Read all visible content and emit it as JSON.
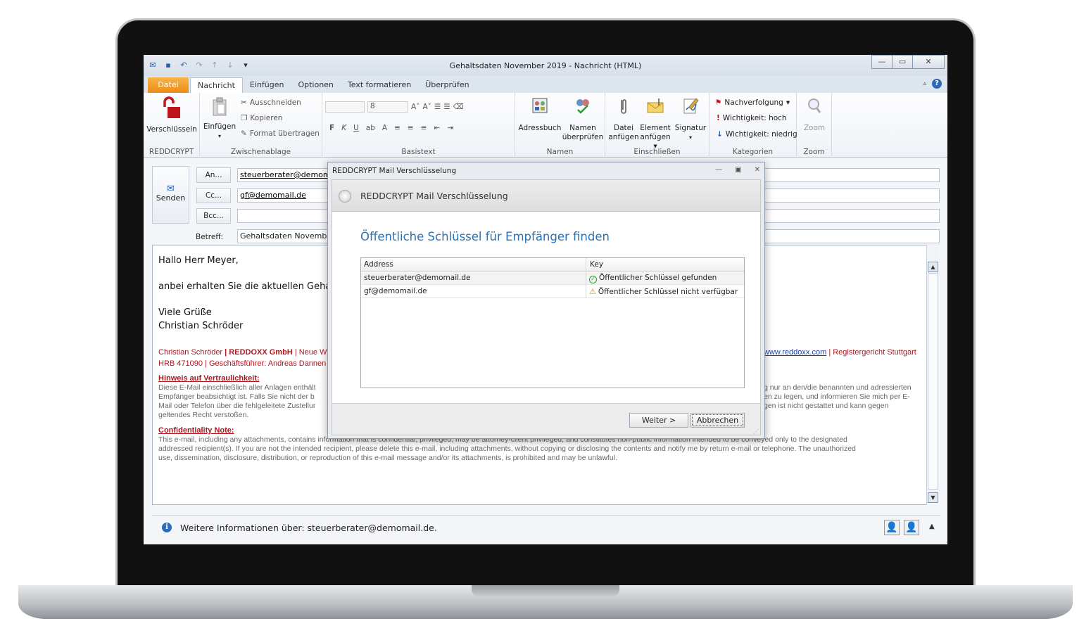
{
  "window": {
    "title": "Gehaltsdaten November 2019  -  Nachricht (HTML)"
  },
  "tabs": [
    "Datei",
    "Nachricht",
    "Einfügen",
    "Optionen",
    "Text formatieren",
    "Überprüfen"
  ],
  "ribbon": {
    "reddcrypt": {
      "button": "Verschlüsseln",
      "group": "REDDCRYPT"
    },
    "clipboard": {
      "paste": "Einfügen",
      "cut": "Ausschneiden",
      "copy": "Kopieren",
      "format": "Format übertragen",
      "group": "Zwischenablage"
    },
    "basictext": {
      "font_size": "8",
      "bold": "F",
      "italic": "K",
      "underline": "U",
      "group": "Basistext"
    },
    "names": {
      "addressbook": "Adressbuch",
      "check_line1": "Namen",
      "check_line2": "überprüfen",
      "group": "Namen"
    },
    "include": {
      "file_line1": "Datei",
      "file_line2": "anfügen",
      "item_line1": "Element",
      "item_line2": "anfügen",
      "signature": "Signatur",
      "group": "Einschließen"
    },
    "tags": {
      "followup": "Nachverfolgung",
      "high": "Wichtigkeit: hoch",
      "low": "Wichtigkeit: niedrig",
      "group": "Kategorien"
    },
    "zoom": {
      "button": "Zoom",
      "group": "Zoom"
    }
  },
  "compose": {
    "send": "Senden",
    "to_btn": "An...",
    "cc_btn": "Cc...",
    "bcc_btn": "Bcc...",
    "subject_label": "Betreff:",
    "to": "steuerberater@demomail.de",
    "cc": "gf@demomail.de",
    "bcc": "",
    "subject": "Gehaltsdaten November 2019"
  },
  "body": {
    "greeting": "Hallo Herr Meyer,",
    "line1": "anbei erhalten Sie die aktuellen Gehalts",
    "closing": "Viele Grüße",
    "name": "Christian Schröder",
    "sig1_name": "Christian Schröder",
    "sig1_company": "REDDOXX GmbH",
    "sig1_rest": "| Neue W",
    "sig1_link": "www.reddoxx.com",
    "sig1_end": "| Registergericht Stuttgart",
    "sig2": "HRB 471090 | Geschäftsführer: Andreas Dannen",
    "hinweis_title": "Hinweis auf Vertraulichkeit:",
    "hinweis_l1": "Diese E-Mail einschließlich aller Anlagen enthält",
    "hinweis_l1r": "g nur an den/die benannten und adressierten",
    "hinweis_l2": "Empfänger beabsichtigt ist. Falls Sie nicht der b",
    "hinweis_l2r": "en zu legen, und informieren Sie mich per E-",
    "hinweis_l3": "Mail oder Telefon über die fehlgeleitete Zustellur",
    "hinweis_l3r": "gen ist nicht gestattet und kann gegen",
    "hinweis_l4": "geltendes Recht verstoßen.",
    "conf_title": "Confidentiality Note:",
    "conf_l1": "This e-mail, including any attachments, contains information that is confidential, privileged, may be attorney-client privileged, and constitutes non-public information intended to be conveyed only to the designated",
    "conf_l2": "addressed recipient(s). If you are not the intended recipient, please delete this e-mail, including attachments, without copying or disclosing the contents and notify me by return e-mail or telephone. The unauthorized",
    "conf_l3": "use, dissemination, disclosure, distribution, or reproduction of this e-mail message and/or its attachments, is prohibited and may be unlawful."
  },
  "status": {
    "text": "Weitere Informationen über: steuerberater@demomail.de."
  },
  "dialog": {
    "title": "REDDCRYPT Mail Verschlüsselung",
    "header": "REDDCRYPT Mail Verschlüsselung",
    "heading": "Öffentliche Schlüssel für Empfänger finden",
    "columns": [
      "Address",
      "Key"
    ],
    "rows": [
      {
        "address": "steuerberater@demomail.de",
        "key": "Öffentlicher Schlüssel gefunden",
        "status_icon": "check-circle-icon"
      },
      {
        "address": "gf@demomail.de",
        "key": "Öffentlicher Schlüssel nicht verfügbar",
        "status_icon": "warning-icon"
      }
    ],
    "next": "Weiter >",
    "cancel": "Abbrechen"
  },
  "colors": {
    "accent": "#2a72b6",
    "file_tab": "#ee8b17",
    "signature_red": "#b0171f",
    "ok_green": "#2c9a35",
    "warn_orange": "#d98b00"
  }
}
